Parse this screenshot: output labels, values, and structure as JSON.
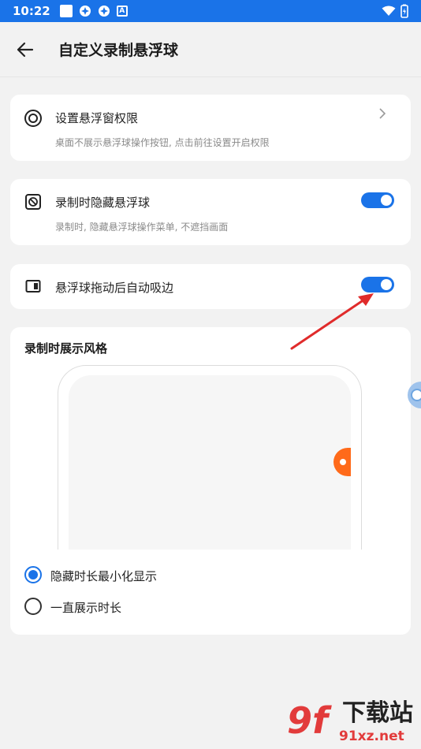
{
  "status_bar": {
    "time": "10:22",
    "icons": [
      "notification-square-icon",
      "pinwheel-icon",
      "pinwheel-icon",
      "a-badge-icon",
      "wifi-icon",
      "battery-charging-icon"
    ]
  },
  "app_bar": {
    "title": "自定义录制悬浮球",
    "back_icon": "arrow-left-icon"
  },
  "settings": {
    "permission": {
      "title": "设置悬浮窗权限",
      "subtitle": "桌面不展示悬浮球操作按钮, 点击前往设置开启权限",
      "icon": "target-circle-icon"
    },
    "hide_ball": {
      "title": "录制时隐藏悬浮球",
      "subtitle": "录制时, 隐藏悬浮球操作菜单, 不遮挡画面",
      "icon": "hide-ball-icon",
      "enabled": true
    },
    "auto_edge": {
      "title": "悬浮球拖动后自动吸边",
      "icon": "edge-snap-icon",
      "enabled": true
    }
  },
  "style_section": {
    "title": "录制时展示风格",
    "options": [
      {
        "label": "隐藏时长最小化显示",
        "selected": true
      },
      {
        "label": "一直展示时长",
        "selected": false
      }
    ]
  },
  "colors": {
    "accent": "#1a73e8",
    "float_ball": "#ff6a1a",
    "annotation_arrow": "#e02b2b"
  },
  "watermark": {
    "logo": "9f",
    "title": "下载站",
    "url": "91xz.net"
  }
}
